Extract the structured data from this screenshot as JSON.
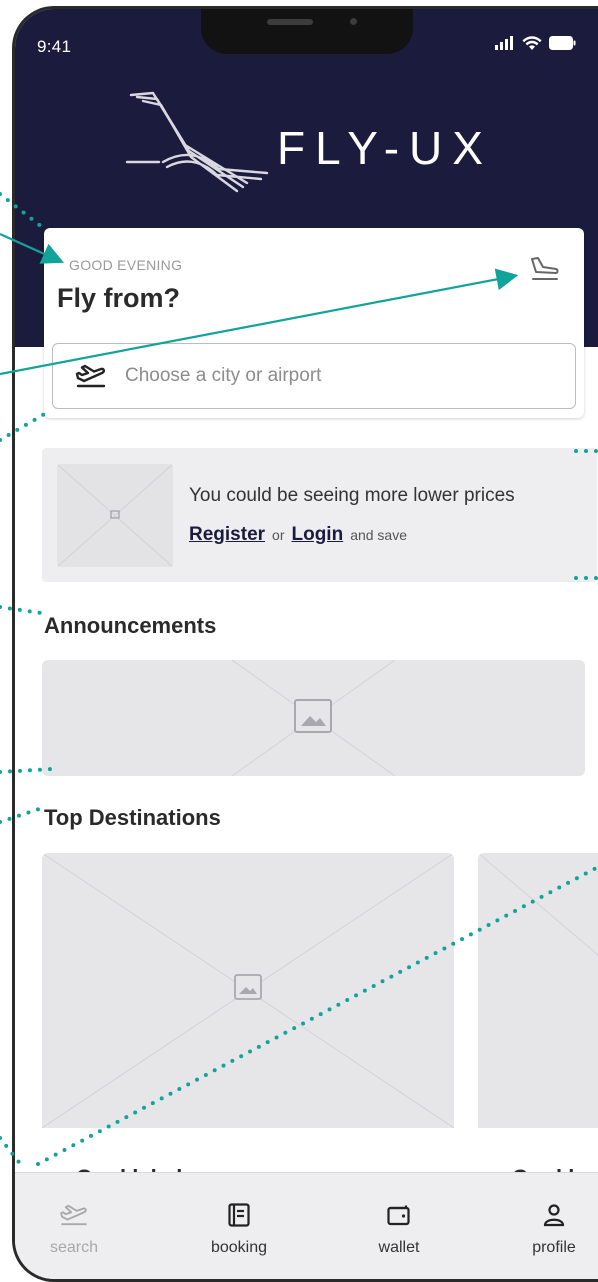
{
  "status_bar": {
    "time": "9:41"
  },
  "brand": {
    "name": "FLY-UX"
  },
  "search_card": {
    "greeting": "GOOD EVENING",
    "title": "Fly from?",
    "input_placeholder": "Choose a city or airport"
  },
  "promo": {
    "text": "You could be seeing more lower prices",
    "register_label": "Register",
    "or_label": "or",
    "login_label": "Login",
    "save_label": "and save"
  },
  "announcements": {
    "title": "Announcements"
  },
  "top_destinations": {
    "title": "Top Destinations",
    "cards": [
      {
        "label": "Card label"
      },
      {
        "label": "Card la"
      }
    ]
  },
  "bottom_nav": {
    "items": [
      {
        "label": "search",
        "icon": "takeoff-icon",
        "active": true
      },
      {
        "label": "booking",
        "icon": "booking-icon",
        "active": false
      },
      {
        "label": "wallet",
        "icon": "wallet-icon",
        "active": false
      },
      {
        "label": "profile",
        "icon": "profile-icon",
        "active": false
      }
    ]
  },
  "colors": {
    "header_bg": "#1b1b3d",
    "annotation": "#12a39a",
    "placeholder": "#e6e6e9"
  }
}
